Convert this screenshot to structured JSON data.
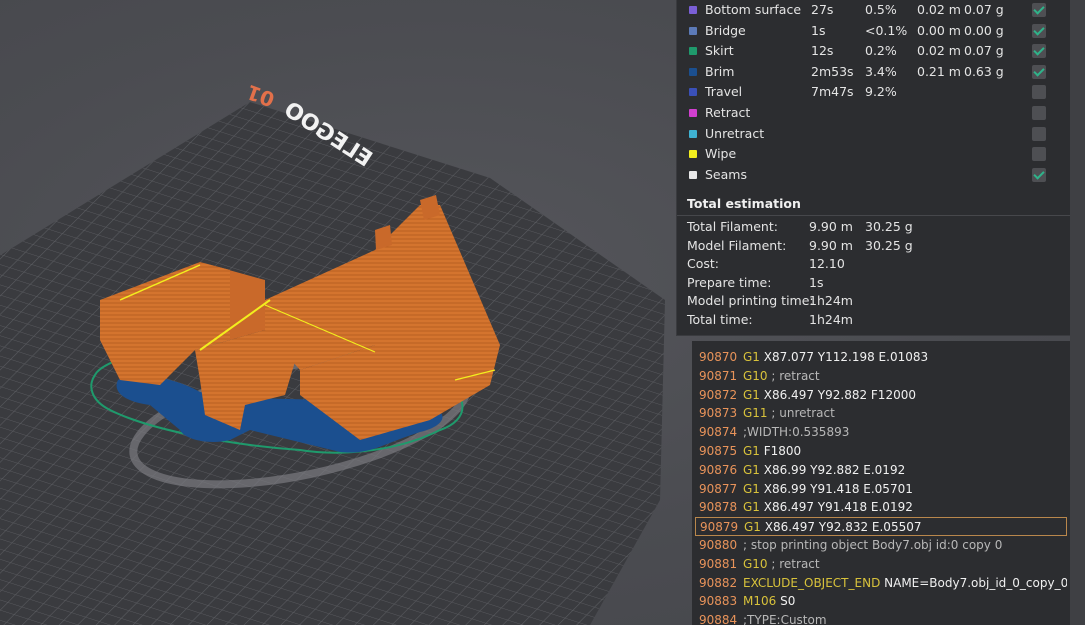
{
  "viewport": {
    "brand": "ELEGOO",
    "plate_number": "01",
    "colors": {
      "model": "#d4742e",
      "brim": "#1b4f8f",
      "skirt": "#1f9a6c",
      "grid": "#5e5f64",
      "bed": "#36373b"
    }
  },
  "legend": {
    "rows": [
      {
        "name": "Bottom surface",
        "time": "27s",
        "percent": "0.5%",
        "length": "0.02 m",
        "weight": "0.07 g",
        "color": "#7a5fd6",
        "checked": true
      },
      {
        "name": "Bridge",
        "time": "1s",
        "percent": "<0.1%",
        "length": "0.00 m",
        "weight": "0.00 g",
        "color": "#5c7ab8",
        "checked": true
      },
      {
        "name": "Skirt",
        "time": "12s",
        "percent": "0.2%",
        "length": "0.02 m",
        "weight": "0.07 g",
        "color": "#1f9a6c",
        "checked": true
      },
      {
        "name": "Brim",
        "time": "2m53s",
        "percent": "3.4%",
        "length": "0.21 m",
        "weight": "0.63 g",
        "color": "#1b4f8f",
        "checked": true
      },
      {
        "name": "Travel",
        "time": "7m47s",
        "percent": "9.2%",
        "length": "",
        "weight": "",
        "color": "#3a50b8",
        "checked": false
      },
      {
        "name": "Retract",
        "time": "",
        "percent": "",
        "length": "",
        "weight": "",
        "color": "#d23fd0",
        "checked": false
      },
      {
        "name": "Unretract",
        "time": "",
        "percent": "",
        "length": "",
        "weight": "",
        "color": "#3fb2d2",
        "checked": false
      },
      {
        "name": "Wipe",
        "time": "",
        "percent": "",
        "length": "",
        "weight": "",
        "color": "#f2ee1e",
        "checked": false
      },
      {
        "name": "Seams",
        "time": "",
        "percent": "",
        "length": "",
        "weight": "",
        "color": "#e8e8e8",
        "checked": true
      }
    ],
    "total_heading": "Total estimation",
    "estimates": [
      {
        "label": "Total Filament:",
        "v1": "9.90 m",
        "v2": "30.25 g"
      },
      {
        "label": "Model Filament:",
        "v1": "9.90 m",
        "v2": "30.25 g"
      },
      {
        "label": "Cost:",
        "v1": "12.10",
        "v2": ""
      },
      {
        "label": "Prepare time:",
        "v1": "1s",
        "v2": ""
      },
      {
        "label": "Model printing time:",
        "v1": "1h24m",
        "v2": ""
      },
      {
        "label": "Total time:",
        "v1": "1h24m",
        "v2": ""
      }
    ]
  },
  "gcode": {
    "lines": [
      {
        "num": "90870",
        "cmd": "G1",
        "args": " X87.077 Y112.198 E.01083",
        "comment": ""
      },
      {
        "num": "90871",
        "cmd": "G10",
        "args": "",
        "comment": " ; retract"
      },
      {
        "num": "90872",
        "cmd": "G1",
        "args": " X86.497 Y92.882 F12000",
        "comment": ""
      },
      {
        "num": "90873",
        "cmd": "G11",
        "args": "",
        "comment": " ; unretract"
      },
      {
        "num": "90874",
        "cmd": "",
        "args": "",
        "comment": ";WIDTH:0.535893"
      },
      {
        "num": "90875",
        "cmd": "G1",
        "args": " F1800",
        "comment": ""
      },
      {
        "num": "90876",
        "cmd": "G1",
        "args": " X86.99 Y92.882 E.0192",
        "comment": ""
      },
      {
        "num": "90877",
        "cmd": "G1",
        "args": " X86.99 Y91.418 E.05701",
        "comment": ""
      },
      {
        "num": "90878",
        "cmd": "G1",
        "args": " X86.497 Y91.418 E.0192",
        "comment": ""
      },
      {
        "num": "90879",
        "cmd": "G1",
        "args": " X86.497 Y92.832 E.05507",
        "comment": "",
        "current": true
      },
      {
        "num": "90880",
        "cmd": "",
        "args": "",
        "comment": "; stop printing object Body7.obj id:0 copy 0"
      },
      {
        "num": "90881",
        "cmd": "G10",
        "args": "",
        "comment": " ; retract"
      },
      {
        "num": "90882",
        "cmd": "EXCLUDE_OBJECT_END",
        "args": " NAME=Body7.obj_id_0_copy_0",
        "comment": ""
      },
      {
        "num": "90883",
        "cmd": "M106",
        "args": " S0",
        "comment": ""
      },
      {
        "num": "90884",
        "cmd": "",
        "args": "",
        "comment": ";TYPE:Custom"
      }
    ]
  }
}
